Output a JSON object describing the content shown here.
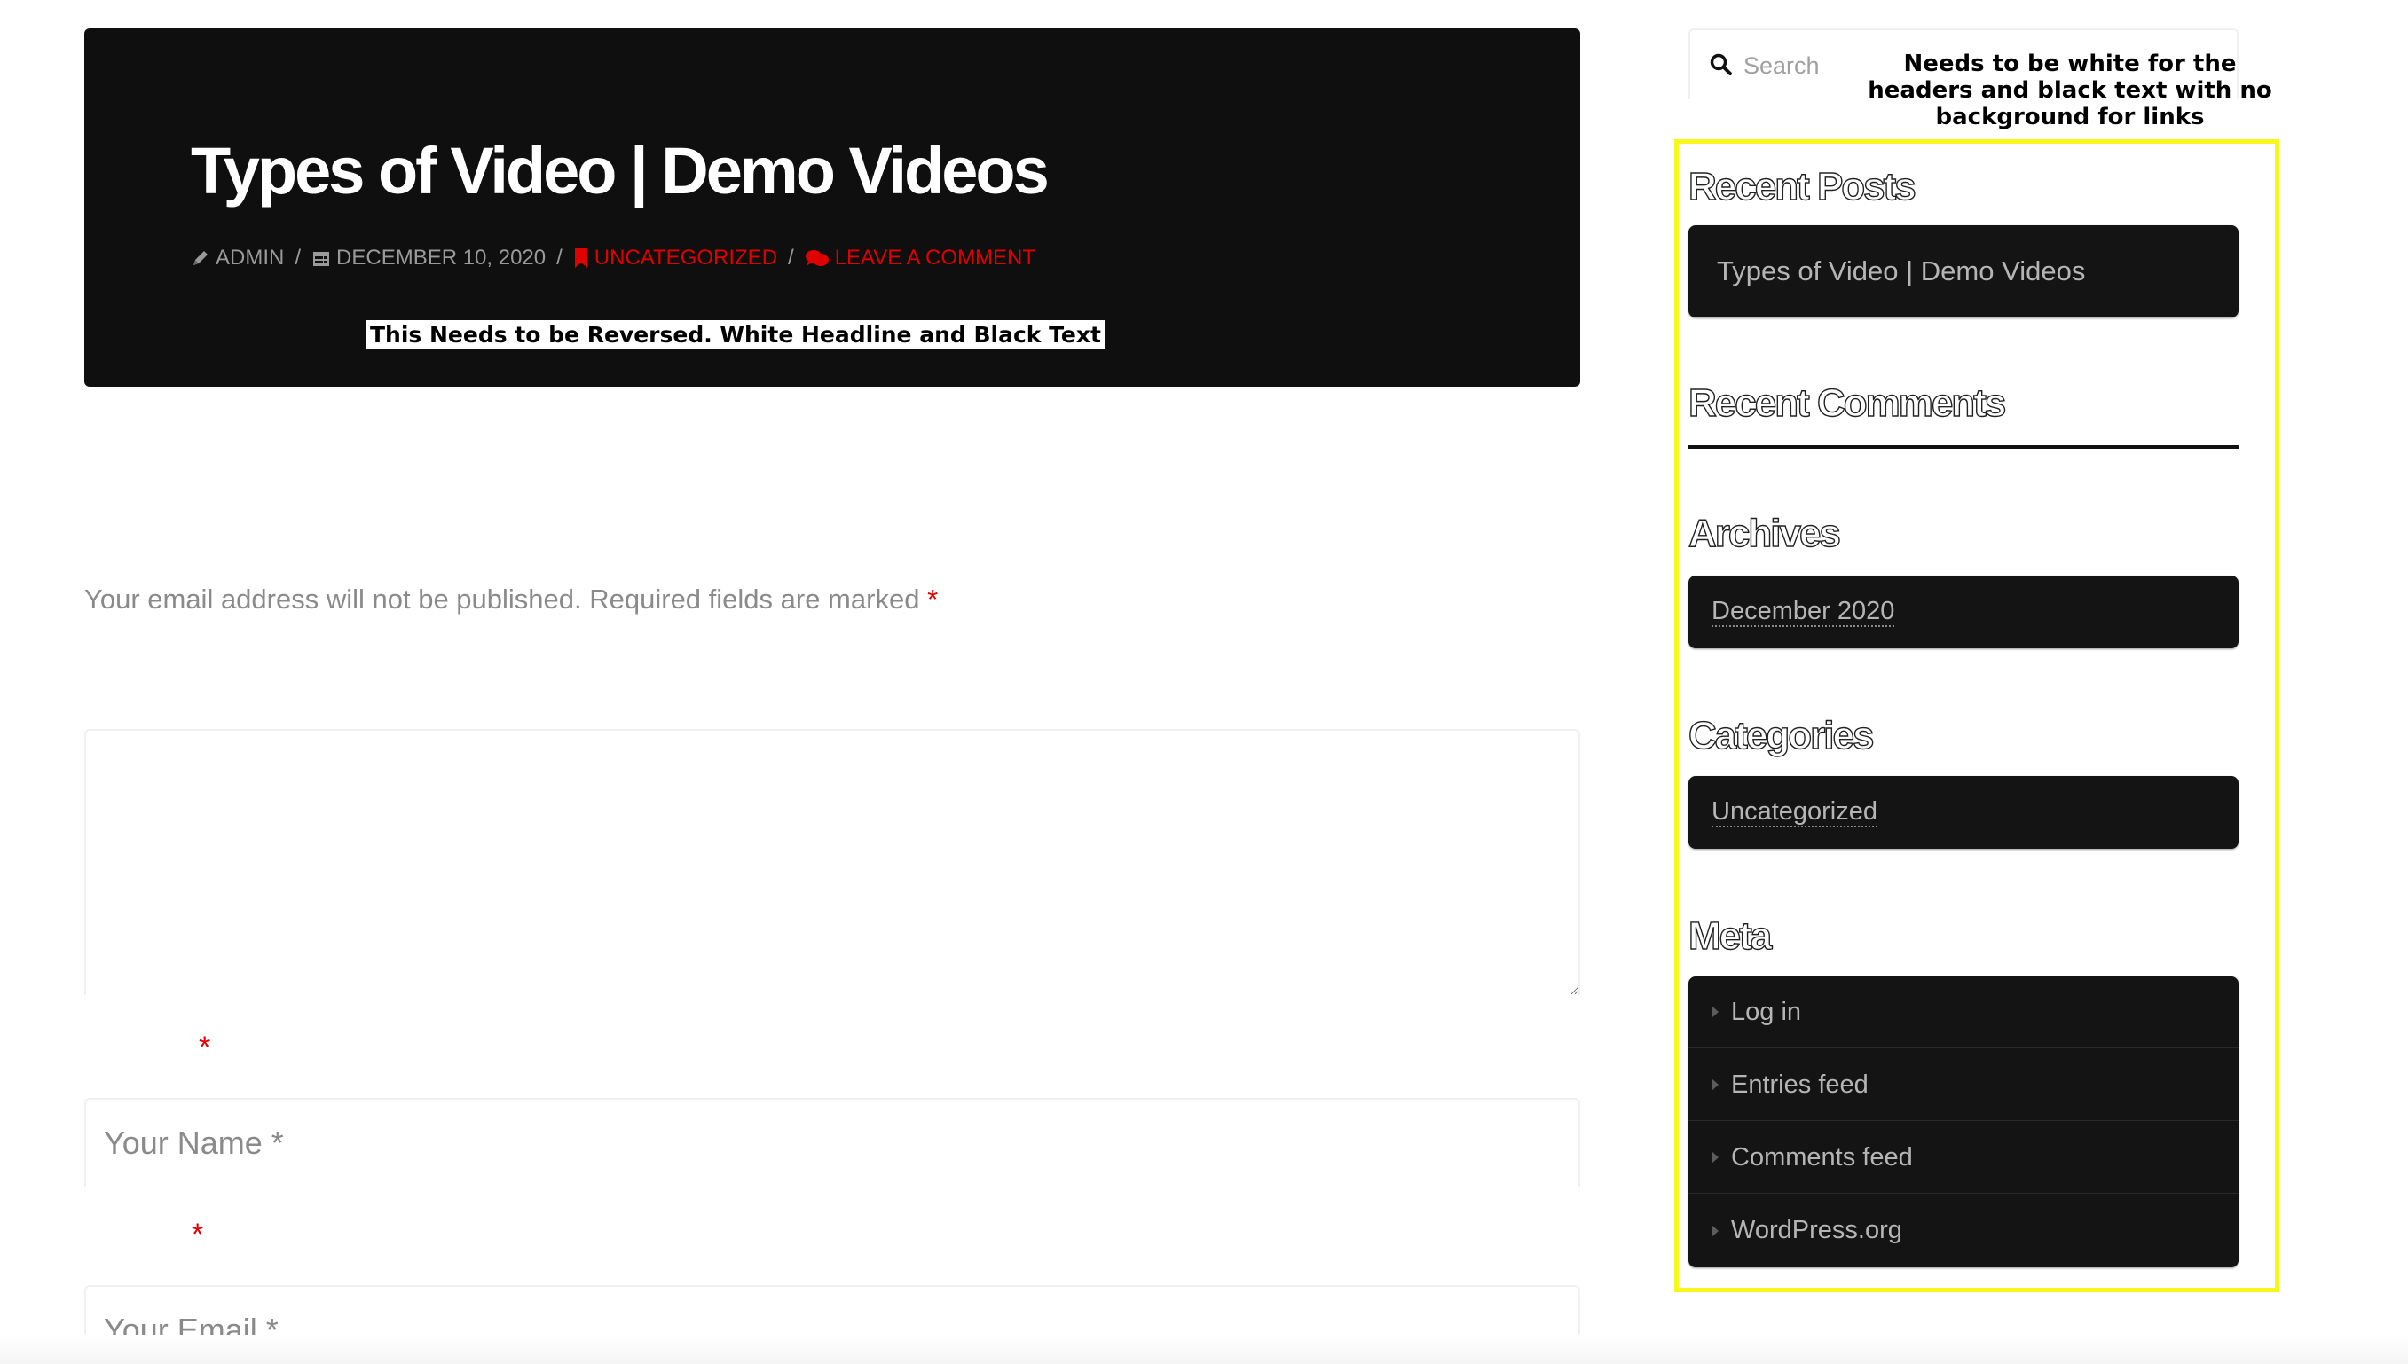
{
  "post": {
    "title": "Types of Video | Demo Videos",
    "meta": {
      "author": "ADMIN",
      "date": "DECEMBER 10, 2020",
      "category": "UNCATEGORIZED",
      "comment_link": "LEAVE A COMMENT",
      "separator": "/"
    },
    "note": "This Needs to be Reversed. White Headline and Black Text"
  },
  "form": {
    "notes": "Your email address will not be published. Required fields are marked",
    "required_star": "*",
    "name_placeholder": "Your Name *",
    "email_placeholder": "Your Email *"
  },
  "sidebar": {
    "search_placeholder": "Search",
    "annotation": "Needs to be white for the headers and black text with no background for links",
    "recent_posts": {
      "title": "Recent Posts",
      "items": [
        "Types of Video | Demo Videos"
      ]
    },
    "recent_comments": {
      "title": "Recent Comments"
    },
    "archives": {
      "title": "Archives",
      "items": [
        "December 2020"
      ]
    },
    "categories": {
      "title": "Categories",
      "items": [
        "Uncategorized"
      ]
    },
    "meta": {
      "title": "Meta",
      "items": [
        "Log in",
        "Entries feed",
        "Comments feed",
        "WordPress.org"
      ]
    }
  },
  "colors": {
    "hero_bg": "#0f0f0f",
    "accent_red": "#e00000",
    "highlight_yellow": "#f7f719",
    "widget_bg": "#141414"
  },
  "icons": [
    "pencil-icon",
    "calendar-icon",
    "bookmark-icon",
    "comments-icon",
    "search-icon",
    "caret-right-icon"
  ]
}
